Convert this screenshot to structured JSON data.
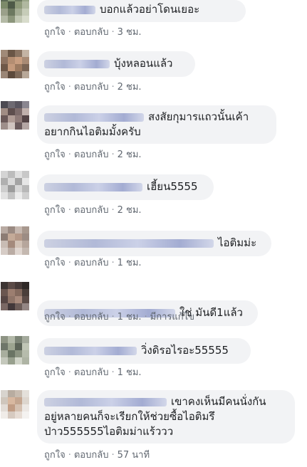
{
  "labels": {
    "like": "ถูกใจ",
    "reply": "ตอบกลับ",
    "dot": "·"
  },
  "comments": [
    {
      "text": "บอกแล้วอย่าโดนเยอะ",
      "time": "3 ชม.",
      "edited": ""
    },
    {
      "text": "บุ้งหลอนแล้ว",
      "time": "2 ชม.",
      "edited": ""
    },
    {
      "text_line1": "สงสัยกุมารแถวนั้นเค้า",
      "text_line2": "อยากกินไอติมมั้งครับ",
      "time": "2 ชม.",
      "edited": ""
    },
    {
      "text": "เฮี้ยน5555",
      "time": "2 ชม.",
      "edited": ""
    },
    {
      "text": "ไอติมม่ะ",
      "time": "1 ชม.",
      "edited": ""
    },
    {
      "text": "ใช่ มันดี1แล้ว",
      "time": "1 ชม.",
      "edited": "มีการแก้ไข"
    },
    {
      "text": "วิ่งดิรอไรอะ55555",
      "time": "1 ชม.",
      "edited": ""
    },
    {
      "text_line1": "เขาคงเห็นมีคนนั่งกัน",
      "text_line2": "อยู่หลายคนก็จะเรียกให้ช่วยซื้อไอติมรึ",
      "text_line3": "ป่าว555555ไอติมม่าแร้ววว",
      "time": "57 นาที",
      "edited": ""
    }
  ]
}
